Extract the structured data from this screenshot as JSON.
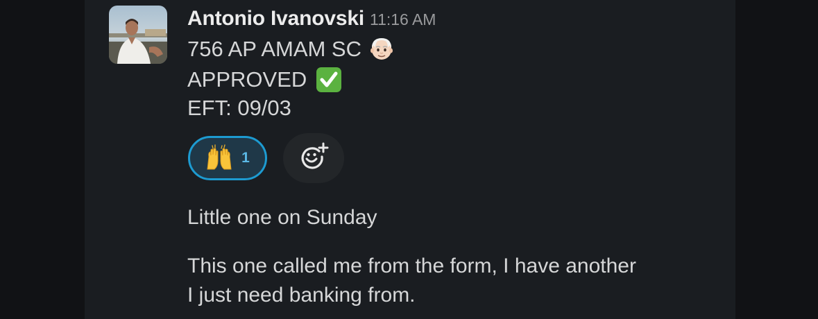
{
  "message": {
    "sender": "Antonio Ivanovski",
    "timestamp": "11:16 AM",
    "lines": [
      "756 AP AMAM SC",
      "APPROVED",
      "EFT: 09/03"
    ]
  },
  "reactions": [
    {
      "emoji": "raising-hands-icon",
      "count": "1",
      "selected": true
    }
  ],
  "followups": [
    "Little one on Sunday",
    "This one called me from the form, I have another",
    "I just need banking from."
  ],
  "icons": {
    "line1_emoji": "older-man-icon",
    "line2_emoji": "check-mark-button-icon",
    "add_reaction": "add-reaction-icon"
  },
  "colors": {
    "background": "#1a1d21",
    "reaction_border": "#1d9bd1",
    "reaction_bg": "#1f3848",
    "check_green": "#5bb240"
  }
}
